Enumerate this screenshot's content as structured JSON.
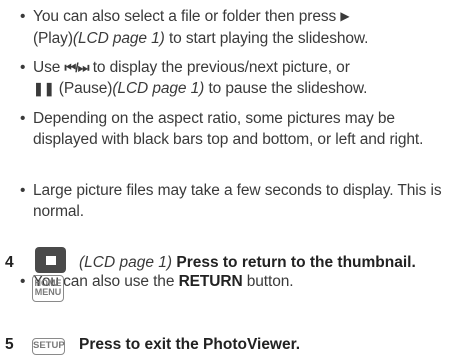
{
  "bullets": [
    {
      "parts": {
        "a": "You can also select a file or folder then press ",
        "play": "▶",
        "b": "(Play)",
        "c": "(LCD page 1)",
        "d": " to start playing the slideshow."
      }
    },
    {
      "parts": {
        "a": "Use ",
        "skip": "⏮/⏭",
        "b": " to display the previous/next picture, or",
        "pause": "❚❚",
        "c": " (Pause)",
        "d": "(LCD page 1)",
        "e": " to pause the slideshow."
      }
    },
    {
      "text": "Depending on the aspect ratio, some pictures may be displayed with black bars top and bottom, or left and right."
    },
    {
      "text": "Large picture files may take a few seconds to display. This is normal."
    }
  ],
  "step4": {
    "number": "4",
    "icon": "stop-icon",
    "lcd_ref": "(LCD page 1)",
    "instruction": "Press to return to the thumbnail.",
    "sub_a": "You can also use the ",
    "sub_b": "RETURN",
    "sub_c": " button."
  },
  "home_key": {
    "line1": "HOME",
    "line2": "MENU"
  },
  "step5": {
    "number": "5",
    "key_label": "SETUP",
    "instruction": "Press to exit the PhotoViewer."
  },
  "bullet_glyph": "•"
}
